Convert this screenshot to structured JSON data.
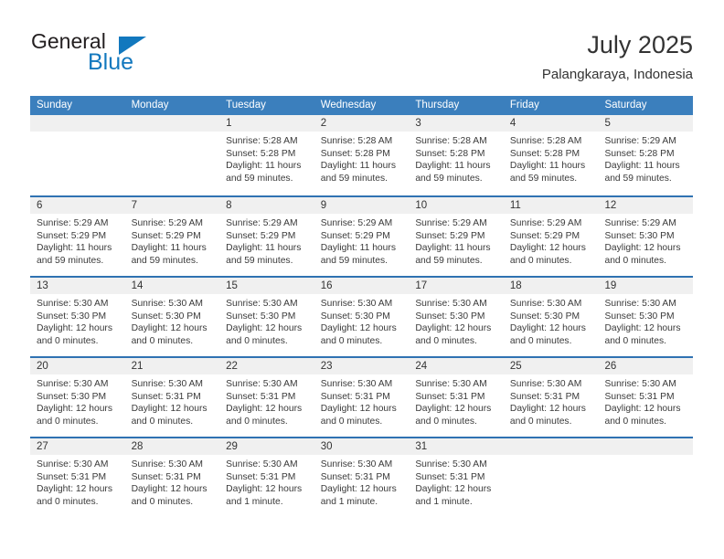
{
  "logo": {
    "word_one": "General",
    "word_two": "Blue",
    "triangle_icon": "triangle-icon",
    "brand_color": "#1278be"
  },
  "header": {
    "title": "July 2025",
    "subtitle": "Palangkaraya, Indonesia"
  },
  "theme": {
    "header_blue": "#3b7fbd",
    "row_divider_blue": "#2f72b2",
    "date_band_gray": "#f0f0f0"
  },
  "calendar": {
    "weekday_headers": [
      "Sunday",
      "Monday",
      "Tuesday",
      "Wednesday",
      "Thursday",
      "Friday",
      "Saturday"
    ],
    "weeks": [
      [
        {
          "day": "",
          "sunrise": "",
          "sunset": "",
          "daylight": "",
          "empty": true
        },
        {
          "day": "",
          "sunrise": "",
          "sunset": "",
          "daylight": "",
          "empty": true
        },
        {
          "day": "1",
          "sunrise": "Sunrise: 5:28 AM",
          "sunset": "Sunset: 5:28 PM",
          "daylight": "Daylight: 11 hours and 59 minutes."
        },
        {
          "day": "2",
          "sunrise": "Sunrise: 5:28 AM",
          "sunset": "Sunset: 5:28 PM",
          "daylight": "Daylight: 11 hours and 59 minutes."
        },
        {
          "day": "3",
          "sunrise": "Sunrise: 5:28 AM",
          "sunset": "Sunset: 5:28 PM",
          "daylight": "Daylight: 11 hours and 59 minutes."
        },
        {
          "day": "4",
          "sunrise": "Sunrise: 5:28 AM",
          "sunset": "Sunset: 5:28 PM",
          "daylight": "Daylight: 11 hours and 59 minutes."
        },
        {
          "day": "5",
          "sunrise": "Sunrise: 5:29 AM",
          "sunset": "Sunset: 5:28 PM",
          "daylight": "Daylight: 11 hours and 59 minutes."
        }
      ],
      [
        {
          "day": "6",
          "sunrise": "Sunrise: 5:29 AM",
          "sunset": "Sunset: 5:29 PM",
          "daylight": "Daylight: 11 hours and 59 minutes."
        },
        {
          "day": "7",
          "sunrise": "Sunrise: 5:29 AM",
          "sunset": "Sunset: 5:29 PM",
          "daylight": "Daylight: 11 hours and 59 minutes."
        },
        {
          "day": "8",
          "sunrise": "Sunrise: 5:29 AM",
          "sunset": "Sunset: 5:29 PM",
          "daylight": "Daylight: 11 hours and 59 minutes."
        },
        {
          "day": "9",
          "sunrise": "Sunrise: 5:29 AM",
          "sunset": "Sunset: 5:29 PM",
          "daylight": "Daylight: 11 hours and 59 minutes."
        },
        {
          "day": "10",
          "sunrise": "Sunrise: 5:29 AM",
          "sunset": "Sunset: 5:29 PM",
          "daylight": "Daylight: 11 hours and 59 minutes."
        },
        {
          "day": "11",
          "sunrise": "Sunrise: 5:29 AM",
          "sunset": "Sunset: 5:29 PM",
          "daylight": "Daylight: 12 hours and 0 minutes."
        },
        {
          "day": "12",
          "sunrise": "Sunrise: 5:29 AM",
          "sunset": "Sunset: 5:30 PM",
          "daylight": "Daylight: 12 hours and 0 minutes."
        }
      ],
      [
        {
          "day": "13",
          "sunrise": "Sunrise: 5:30 AM",
          "sunset": "Sunset: 5:30 PM",
          "daylight": "Daylight: 12 hours and 0 minutes."
        },
        {
          "day": "14",
          "sunrise": "Sunrise: 5:30 AM",
          "sunset": "Sunset: 5:30 PM",
          "daylight": "Daylight: 12 hours and 0 minutes."
        },
        {
          "day": "15",
          "sunrise": "Sunrise: 5:30 AM",
          "sunset": "Sunset: 5:30 PM",
          "daylight": "Daylight: 12 hours and 0 minutes."
        },
        {
          "day": "16",
          "sunrise": "Sunrise: 5:30 AM",
          "sunset": "Sunset: 5:30 PM",
          "daylight": "Daylight: 12 hours and 0 minutes."
        },
        {
          "day": "17",
          "sunrise": "Sunrise: 5:30 AM",
          "sunset": "Sunset: 5:30 PM",
          "daylight": "Daylight: 12 hours and 0 minutes."
        },
        {
          "day": "18",
          "sunrise": "Sunrise: 5:30 AM",
          "sunset": "Sunset: 5:30 PM",
          "daylight": "Daylight: 12 hours and 0 minutes."
        },
        {
          "day": "19",
          "sunrise": "Sunrise: 5:30 AM",
          "sunset": "Sunset: 5:30 PM",
          "daylight": "Daylight: 12 hours and 0 minutes."
        }
      ],
      [
        {
          "day": "20",
          "sunrise": "Sunrise: 5:30 AM",
          "sunset": "Sunset: 5:30 PM",
          "daylight": "Daylight: 12 hours and 0 minutes."
        },
        {
          "day": "21",
          "sunrise": "Sunrise: 5:30 AM",
          "sunset": "Sunset: 5:31 PM",
          "daylight": "Daylight: 12 hours and 0 minutes."
        },
        {
          "day": "22",
          "sunrise": "Sunrise: 5:30 AM",
          "sunset": "Sunset: 5:31 PM",
          "daylight": "Daylight: 12 hours and 0 minutes."
        },
        {
          "day": "23",
          "sunrise": "Sunrise: 5:30 AM",
          "sunset": "Sunset: 5:31 PM",
          "daylight": "Daylight: 12 hours and 0 minutes."
        },
        {
          "day": "24",
          "sunrise": "Sunrise: 5:30 AM",
          "sunset": "Sunset: 5:31 PM",
          "daylight": "Daylight: 12 hours and 0 minutes."
        },
        {
          "day": "25",
          "sunrise": "Sunrise: 5:30 AM",
          "sunset": "Sunset: 5:31 PM",
          "daylight": "Daylight: 12 hours and 0 minutes."
        },
        {
          "day": "26",
          "sunrise": "Sunrise: 5:30 AM",
          "sunset": "Sunset: 5:31 PM",
          "daylight": "Daylight: 12 hours and 0 minutes."
        }
      ],
      [
        {
          "day": "27",
          "sunrise": "Sunrise: 5:30 AM",
          "sunset": "Sunset: 5:31 PM",
          "daylight": "Daylight: 12 hours and 0 minutes."
        },
        {
          "day": "28",
          "sunrise": "Sunrise: 5:30 AM",
          "sunset": "Sunset: 5:31 PM",
          "daylight": "Daylight: 12 hours and 0 minutes."
        },
        {
          "day": "29",
          "sunrise": "Sunrise: 5:30 AM",
          "sunset": "Sunset: 5:31 PM",
          "daylight": "Daylight: 12 hours and 1 minute."
        },
        {
          "day": "30",
          "sunrise": "Sunrise: 5:30 AM",
          "sunset": "Sunset: 5:31 PM",
          "daylight": "Daylight: 12 hours and 1 minute."
        },
        {
          "day": "31",
          "sunrise": "Sunrise: 5:30 AM",
          "sunset": "Sunset: 5:31 PM",
          "daylight": "Daylight: 12 hours and 1 minute."
        },
        {
          "day": "",
          "sunrise": "",
          "sunset": "",
          "daylight": "",
          "empty": true
        },
        {
          "day": "",
          "sunrise": "",
          "sunset": "",
          "daylight": "",
          "empty": true
        }
      ]
    ]
  }
}
